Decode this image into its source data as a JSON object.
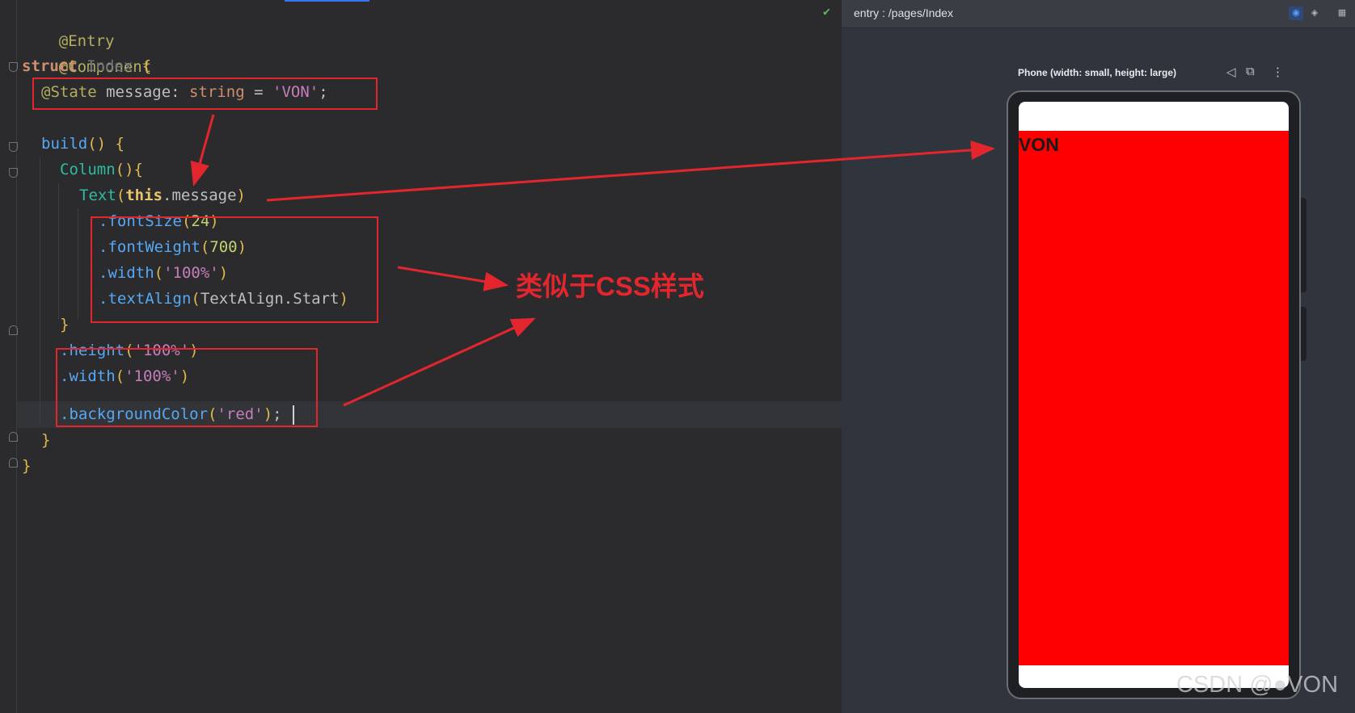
{
  "editor": {
    "line1": {
      "a": "@Entry"
    },
    "line2": {
      "a": "@Component"
    },
    "line3": {
      "kw": "struct",
      "cls": "Index",
      "br": "{"
    },
    "line4": {
      "ann": "@State",
      "var": " message",
      "punct": ": ",
      "type": "string",
      "eq": " = ",
      "str": "'VON'",
      "end": ";"
    },
    "line6": {
      "fn": "build",
      "paren": "()",
      "br": " {"
    },
    "line7": {
      "comp": "Column",
      "paren": "()",
      "br": "{"
    },
    "line8": {
      "comp": "Text",
      "p1": "(",
      "this": "this",
      "dot": ".",
      "var": "message",
      "p2": ")"
    },
    "line9": {
      "fn": ".fontSize",
      "p1": "(",
      "num": "24",
      "p2": ")"
    },
    "line10": {
      "fn": ".fontWeight",
      "p1": "(",
      "num": "700",
      "p2": ")"
    },
    "line11": {
      "fn": ".width",
      "p1": "(",
      "str": "'100%'",
      "p2": ")"
    },
    "line12": {
      "fn": ".textAlign",
      "p1": "(",
      "var": "TextAlign",
      "dot": ".",
      "prop": "Start",
      "p2": ")"
    },
    "line13": {
      "br": "}"
    },
    "line14": {
      "fn": ".height",
      "p1": "(",
      "str": "'100%'",
      "p2": ")"
    },
    "line15": {
      "fn": ".width",
      "p1": "(",
      "str": "'100%'",
      "p2": ")"
    },
    "line16": {
      "fn": ".backgroundColor",
      "p1": "(",
      "str": "'red'",
      "p2": ")",
      "end": ";"
    },
    "line17": {
      "br": "}"
    },
    "line18": {
      "br": "}"
    }
  },
  "preview": {
    "title": "entry : /pages/Index",
    "device_label": "Phone (width: small, height: large)",
    "app_text": "VON",
    "toolbar_icons": [
      "eye-icon",
      "layers-icon",
      "grid-icon"
    ],
    "device_icons": [
      "rotate-icon",
      "fold-icon",
      "more-icon"
    ]
  },
  "annotation": {
    "text": "类似于CSS样式"
  },
  "watermark": "CSDN @●VON",
  "colors": {
    "highlight": "#e3262e",
    "app_background": "#ff0000"
  }
}
